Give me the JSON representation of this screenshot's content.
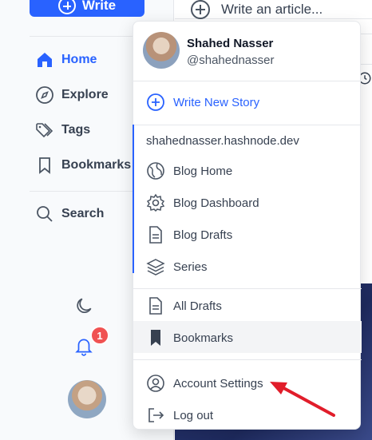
{
  "sidebar": {
    "write_button": "Write",
    "nav": [
      {
        "label": "Home",
        "icon": "home-icon",
        "active": true
      },
      {
        "label": "Explore",
        "icon": "compass-icon",
        "active": false
      },
      {
        "label": "Tags",
        "icon": "tags-icon",
        "active": false
      },
      {
        "label": "Bookmarks",
        "icon": "bookmark-icon",
        "active": false
      },
      {
        "label": "Search",
        "icon": "search-icon",
        "active": false
      }
    ],
    "notification_count": "1"
  },
  "main": {
    "write_article_placeholder": "Write an article..."
  },
  "menu": {
    "profile": {
      "name": "Shahed Nasser",
      "handle": "@shahednasser"
    },
    "write_new_story": "Write New Story",
    "blog_domain": "shahednasser.hashnode.dev",
    "blog_items": [
      {
        "label": "Blog Home",
        "icon": "globe-icon"
      },
      {
        "label": "Blog Dashboard",
        "icon": "gear-icon"
      },
      {
        "label": "Blog Drafts",
        "icon": "document-icon"
      },
      {
        "label": "Series",
        "icon": "layers-icon"
      }
    ],
    "draft_items": [
      {
        "label": "All Drafts",
        "icon": "document-icon"
      },
      {
        "label": "Bookmarks",
        "icon": "bookmark-filled-icon",
        "highlighted": true
      }
    ],
    "account_items": [
      {
        "label": "Account Settings",
        "icon": "user-circle-icon"
      },
      {
        "label": "Log out",
        "icon": "logout-icon"
      }
    ]
  },
  "colors": {
    "accent": "#2962ff",
    "badge": "#f05252",
    "annotation_arrow": "#e11d2a"
  }
}
